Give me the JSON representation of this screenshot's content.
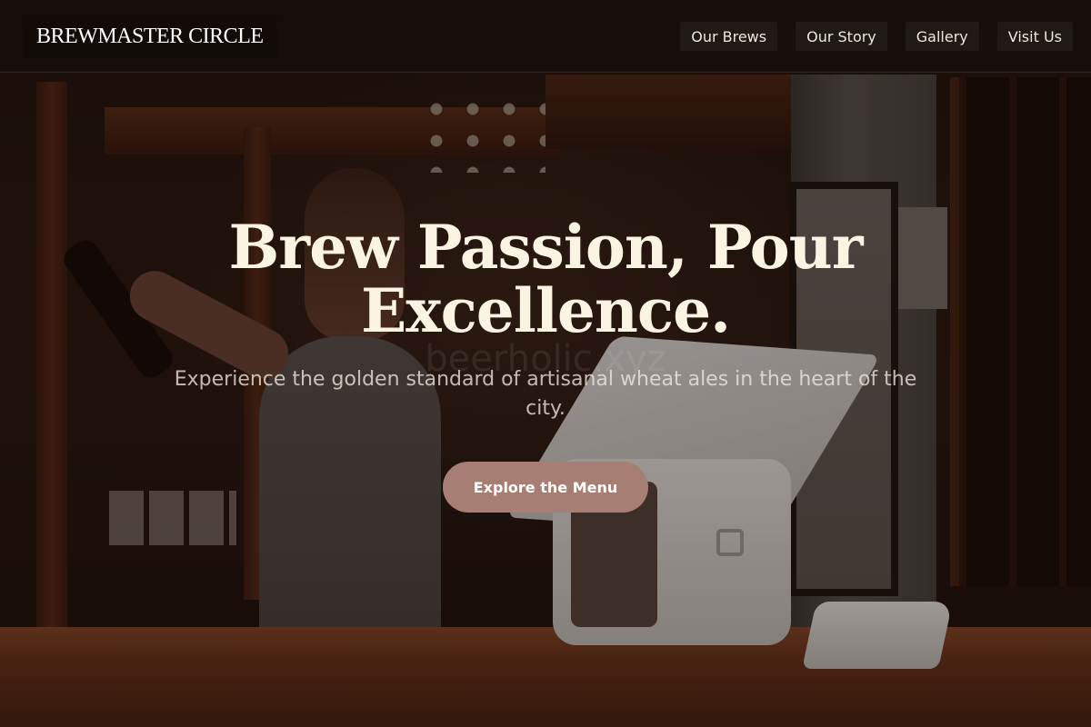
{
  "header": {
    "brand": "BREWMASTER CIRCLE",
    "nav": [
      {
        "label": "Our Brews"
      },
      {
        "label": "Our Story"
      },
      {
        "label": "Gallery"
      },
      {
        "label": "Visit Us"
      }
    ]
  },
  "hero": {
    "title": "Brew Passion, Pour Excellence.",
    "subtitle": "Experience the golden standard of artisanal wheat ales in the heart of the city.",
    "cta_label": "Explore the Menu",
    "watermark": "beerholic.xyz"
  },
  "colors": {
    "header_bg": "#140e0b",
    "title": "#fbf4e3",
    "cta_bg": "#a67e74"
  }
}
